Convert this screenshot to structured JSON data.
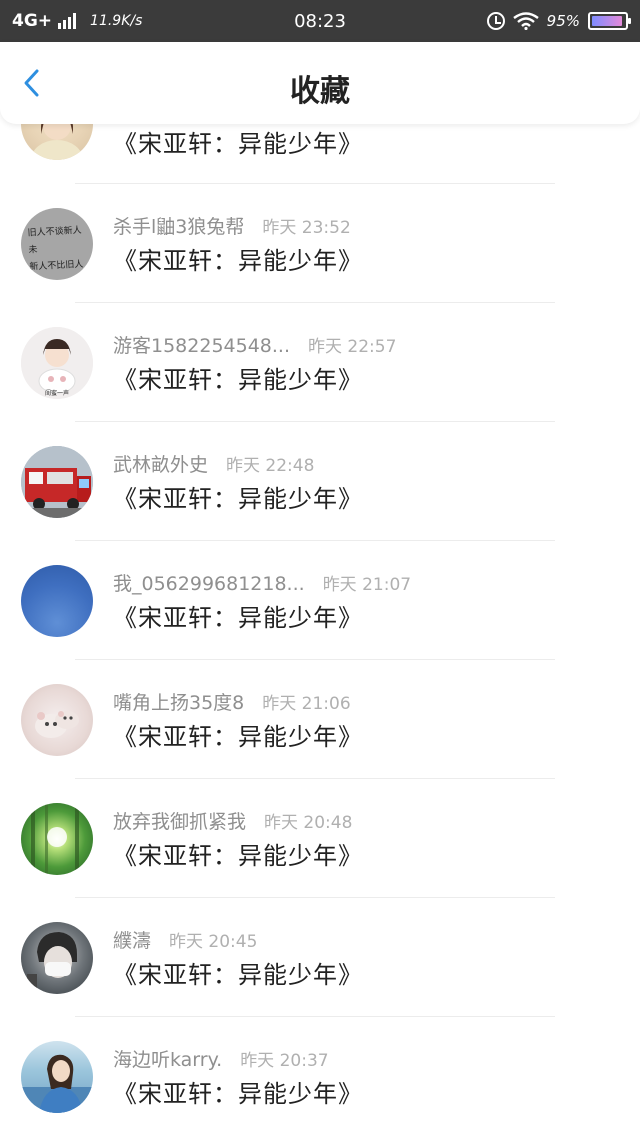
{
  "status_bar": {
    "network": "4G+",
    "speed": "11.9K/s",
    "time": "08:23",
    "battery": "95%",
    "battery_level": 0.95
  },
  "header": {
    "title": "收藏",
    "back_icon": "chevron-left-icon",
    "accent_color": "#2e8fe0"
  },
  "list": {
    "first_comment": "《宋亚轩：异能少年》",
    "items": [
      {
        "username": "杀手l鼬3狼兔帮",
        "time": "昨天 23:52",
        "comment": "《宋亚轩：异能少年》"
      },
      {
        "username": "游客1582254548...",
        "time": "昨天 22:57",
        "comment": "《宋亚轩：异能少年》"
      },
      {
        "username": "武林畝外史",
        "time": "昨天 22:48",
        "comment": "《宋亚轩：异能少年》"
      },
      {
        "username": "我_056299681218...",
        "time": "昨天 21:07",
        "comment": "《宋亚轩：异能少年》"
      },
      {
        "username": "嘴角上扬35度8",
        "time": "昨天 21:06",
        "comment": "《宋亚轩：异能少年》"
      },
      {
        "username": "放弃我御抓紧我",
        "time": "昨天 20:48",
        "comment": "《宋亚轩：异能少年》"
      },
      {
        "username": "纀濤",
        "time": "昨天 20:45",
        "comment": "《宋亚轩：异能少年》"
      },
      {
        "username": "海边听karry.",
        "time": "昨天 20:37",
        "comment": "《宋亚轩：异能少年》"
      }
    ],
    "avatar_text": {
      "line1": "旧人不谈新人未",
      "line2": "新人不比旧人深"
    },
    "avatar_caption": "闺蜜一声"
  }
}
